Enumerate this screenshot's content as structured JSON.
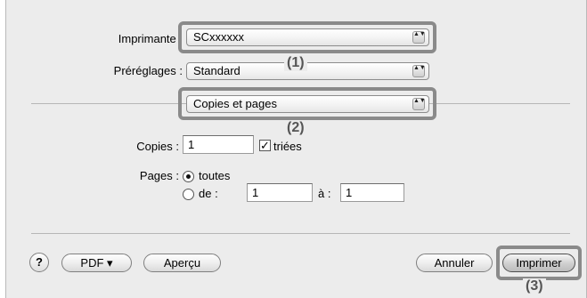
{
  "printer": {
    "label": "Imprimante :",
    "value": "SCxxxxxx"
  },
  "presets": {
    "label": "Préréglages :",
    "value": "Standard"
  },
  "panel_menu": {
    "value": "Copies et pages"
  },
  "arrows_glyph": "▲▼",
  "copies": {
    "label": "Copies :",
    "value": "1",
    "collate_label": "triées",
    "collate_check": "✓"
  },
  "pages": {
    "label": "Pages :",
    "all_label": "toutes",
    "from_label": "de :",
    "from_value": "1",
    "to_label": "à :",
    "to_value": "1"
  },
  "footer": {
    "help": "?",
    "pdf": "PDF ▾",
    "preview": "Aperçu",
    "cancel": "Annuler",
    "print": "Imprimer"
  },
  "callouts": {
    "one": "(1)",
    "two": "(2)",
    "three": "(3)"
  }
}
